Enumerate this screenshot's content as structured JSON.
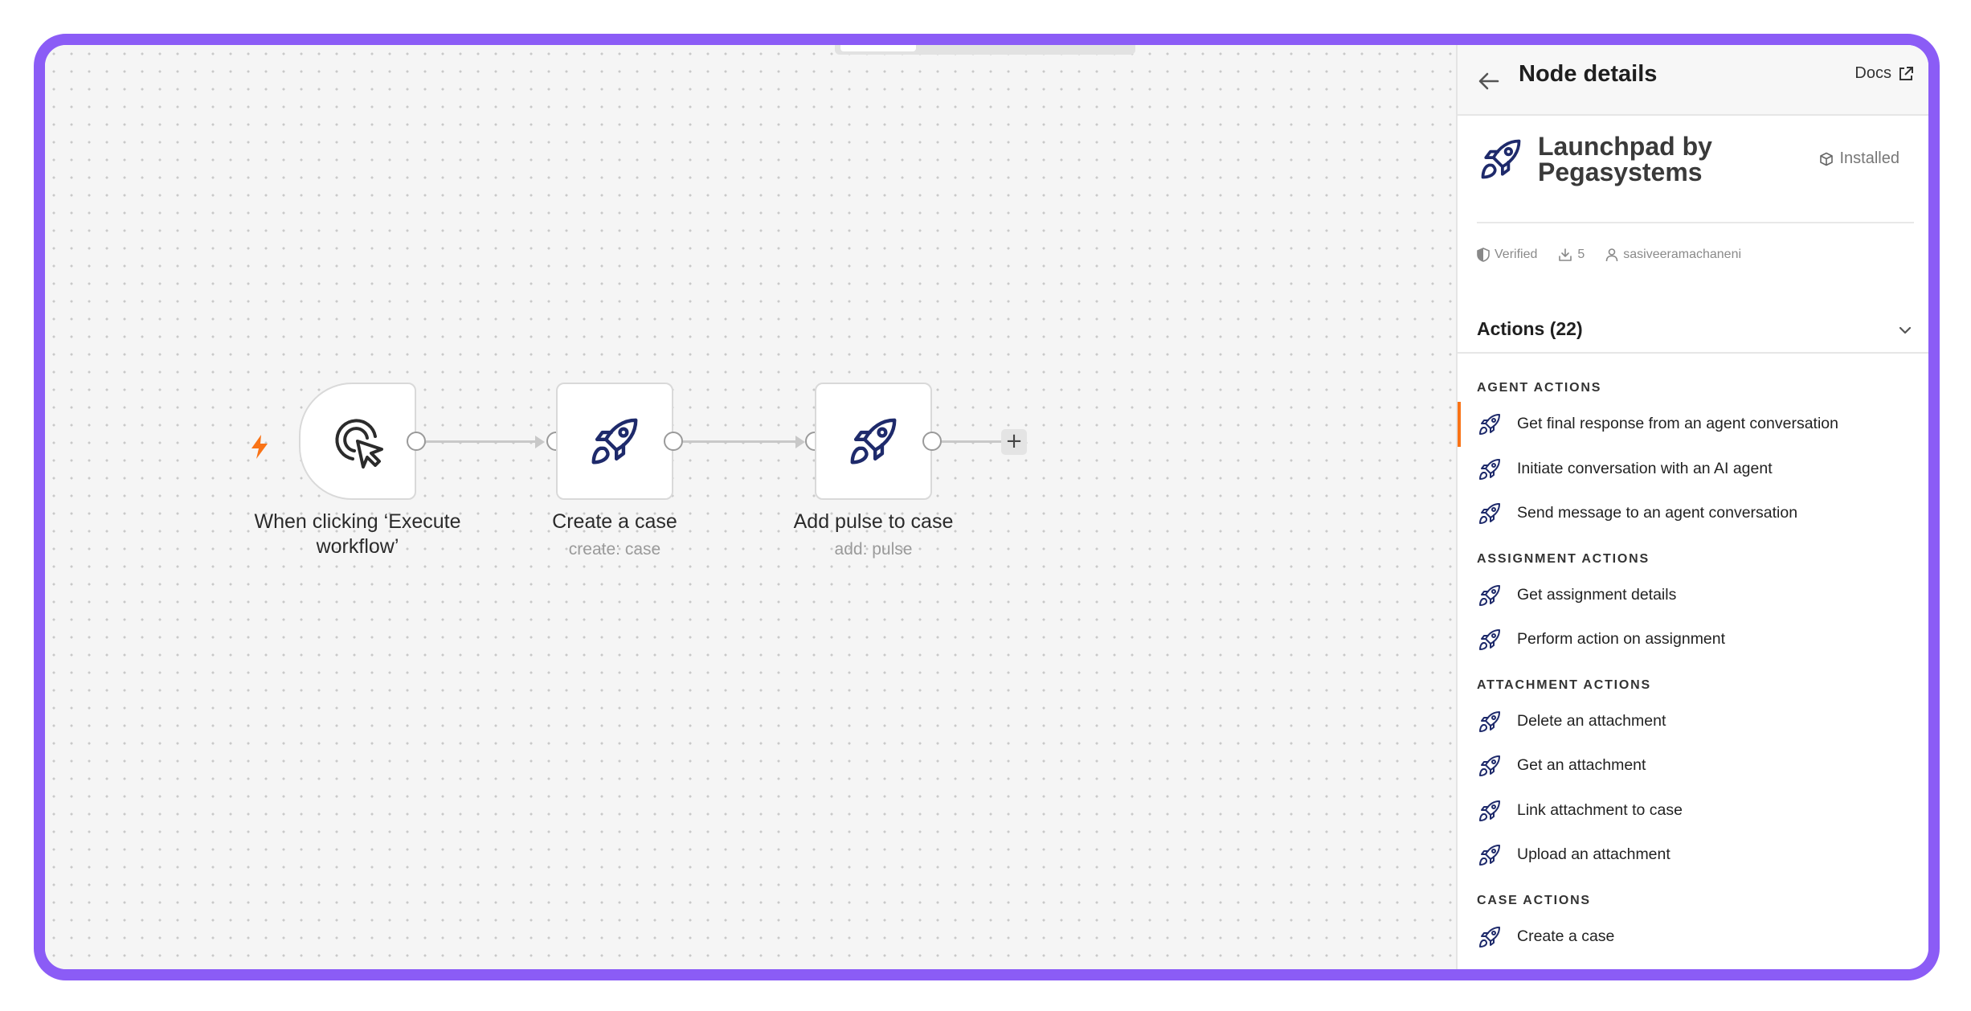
{
  "workflow": {
    "nodes": [
      {
        "title": "When clicking ‘Execute workflow’",
        "subtitle": "",
        "icon": "cursor-click-icon",
        "trigger": true
      },
      {
        "title": "Create a case",
        "subtitle": "create: case",
        "icon": "rocket-icon"
      },
      {
        "title": "Add pulse to case",
        "subtitle": "add: pulse",
        "icon": "rocket-icon"
      }
    ],
    "add_label": "+",
    "trigger_badge_color": "#f97316"
  },
  "panel": {
    "title": "Node details",
    "docs_label": "Docs",
    "package": {
      "name": "Launchpad by Pegasystems",
      "status": "Installed",
      "verified": "Verified",
      "downloads": "5",
      "author": "sasiveeramachaneni"
    },
    "actions_header": "Actions (22)",
    "sections": [
      {
        "label": "AGENT ACTIONS",
        "items": [
          "Get final response from an agent conversation",
          "Initiate conversation with an AI agent",
          "Send message to an agent conversation"
        ]
      },
      {
        "label": "ASSIGNMENT ACTIONS",
        "items": [
          "Get assignment details",
          "Perform action on assignment"
        ]
      },
      {
        "label": "ATTACHMENT ACTIONS",
        "items": [
          "Delete an attachment",
          "Get an attachment",
          "Link attachment to case",
          "Upload an attachment"
        ]
      },
      {
        "label": "CASE ACTIONS",
        "items": [
          "Create a case"
        ]
      }
    ]
  },
  "colors": {
    "frame": "#8b5cf6",
    "accent": "#f97316",
    "icon": "#1e2a6b"
  }
}
